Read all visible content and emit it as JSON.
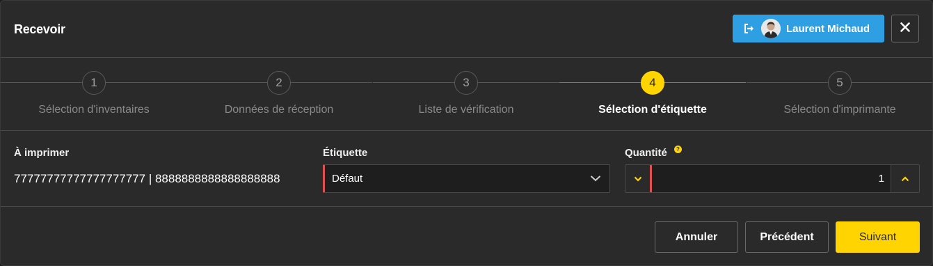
{
  "header": {
    "title": "Recevoir",
    "user_name": "Laurent Michaud"
  },
  "steps": [
    {
      "number": "1",
      "label": "Sélection d'inventaires"
    },
    {
      "number": "2",
      "label": "Données de réception"
    },
    {
      "number": "3",
      "label": "Liste de vérification"
    },
    {
      "number": "4",
      "label": "Sélection d'étiquette"
    },
    {
      "number": "5",
      "label": "Sélection d'imprimante"
    }
  ],
  "active_step": 4,
  "form": {
    "print_label": "À imprimer",
    "print_value": "77777777777777777777 | 8888888888888888888",
    "etiquette_label": "Étiquette",
    "etiquette_value": "Défaut",
    "quantity_label": "Quantité",
    "quantity_value": "1"
  },
  "footer": {
    "cancel": "Annuler",
    "previous": "Précédent",
    "next": "Suivant"
  },
  "colors": {
    "accent_yellow": "#ffd400",
    "user_blue": "#2f9fe3",
    "required_red": "#e05050"
  }
}
